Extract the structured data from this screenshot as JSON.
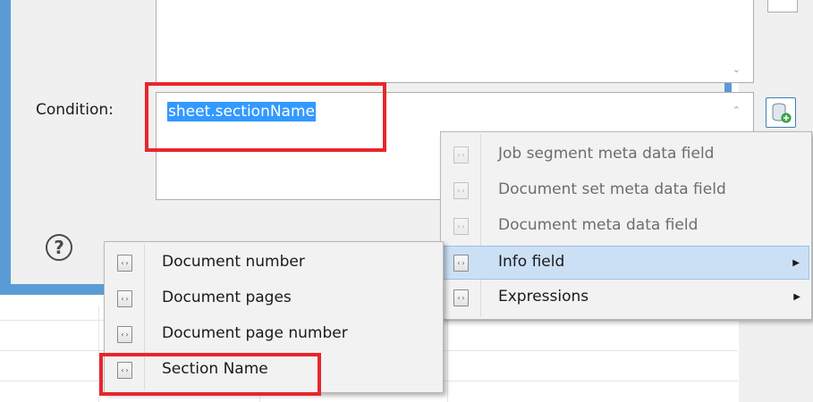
{
  "dialog": {
    "condition_label": "Condition:",
    "condition_value": "sheet.sectionName",
    "help_icon_glyph": "?",
    "scroll_up_glyph": "⌃",
    "scroll_down_glyph": "⌄"
  },
  "context_menu": {
    "items": [
      {
        "label": "Job segment meta data field",
        "enabled": false,
        "icon": "field-icon"
      },
      {
        "label": "Document set meta data field",
        "enabled": false,
        "icon": "field-icon"
      },
      {
        "label": "Document meta data field",
        "enabled": false,
        "icon": "field-icon"
      },
      {
        "label": "Info field",
        "enabled": true,
        "icon": "field-icon",
        "submenu": true,
        "active": true
      },
      {
        "label": "Expressions",
        "enabled": true,
        "icon": "field-icon",
        "submenu": true
      }
    ],
    "submenu_arrow": "▶"
  },
  "info_submenu": {
    "items": [
      {
        "label": "Document number",
        "icon": "field-icon"
      },
      {
        "label": "Document pages",
        "icon": "field-icon"
      },
      {
        "label": "Document page number",
        "icon": "field-icon"
      },
      {
        "label": "Section Name",
        "icon": "field-icon",
        "highlighted": true
      }
    ]
  },
  "icon_glyph": "‹›",
  "colors": {
    "dialog_border": "#5b9bd5",
    "selection": "#3399ff",
    "highlight_box": "#e8262c",
    "menu_active": "#cce0f5"
  }
}
